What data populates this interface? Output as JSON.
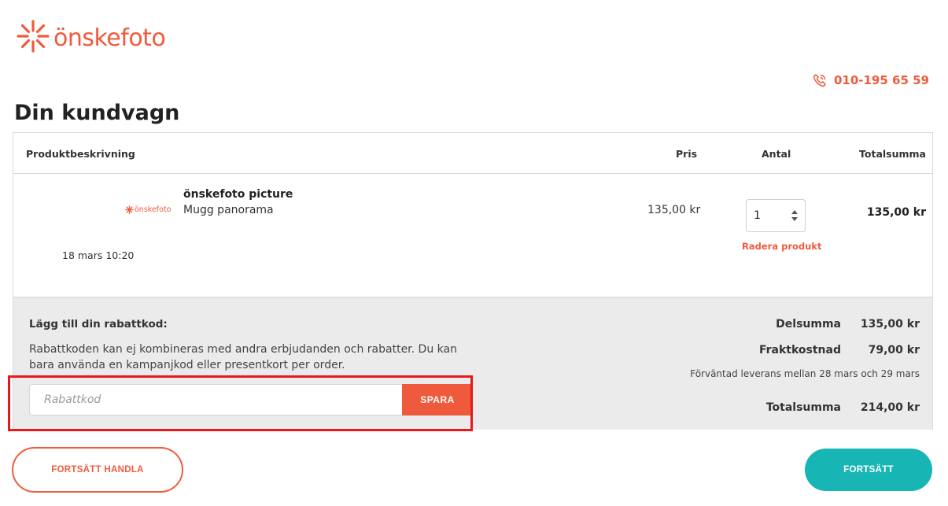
{
  "brand": {
    "name": "önskefoto",
    "accent": "#f05a3c",
    "teal": "#18b5b5",
    "logo_icon": "sunburst-logo-icon"
  },
  "header": {
    "phone": "010-195 65 59",
    "phone_icon": "phone-icon"
  },
  "page_title": "Din kundvagn",
  "cart": {
    "columns": [
      "Produktbeskrivning",
      "Pris",
      "Antal",
      "Totalsumma"
    ],
    "items": [
      {
        "thumb_text": "önskefoto",
        "name": "önskefoto picture",
        "variant": "Mugg panorama",
        "date": "18 mars 10:20",
        "price": "135,00 kr",
        "qty": "1",
        "remove_label": "Radera produkt",
        "total": "135,00 kr"
      }
    ]
  },
  "coupon": {
    "title": "Lägg till din rabattkod:",
    "note": "Rabattkoden kan ej kombineras med andra erbjudanden och rabatter. Du kan bara använda en kampanjkod eller presentkort per order.",
    "placeholder": "Rabattkod",
    "value": "",
    "save_label": "SPARA"
  },
  "summary": {
    "subtotal_label": "Delsumma",
    "subtotal": "135,00 kr",
    "shipping_label": "Fraktkostnad",
    "shipping": "79,00 kr",
    "delivery_note": "Förväntad leverans mellan 28 mars och 29 mars",
    "total_label": "Totalsumma",
    "total": "214,00 kr"
  },
  "actions": {
    "continue_shopping": "FORTSÄTT HANDLA",
    "continue": "FORTSÄTT"
  }
}
